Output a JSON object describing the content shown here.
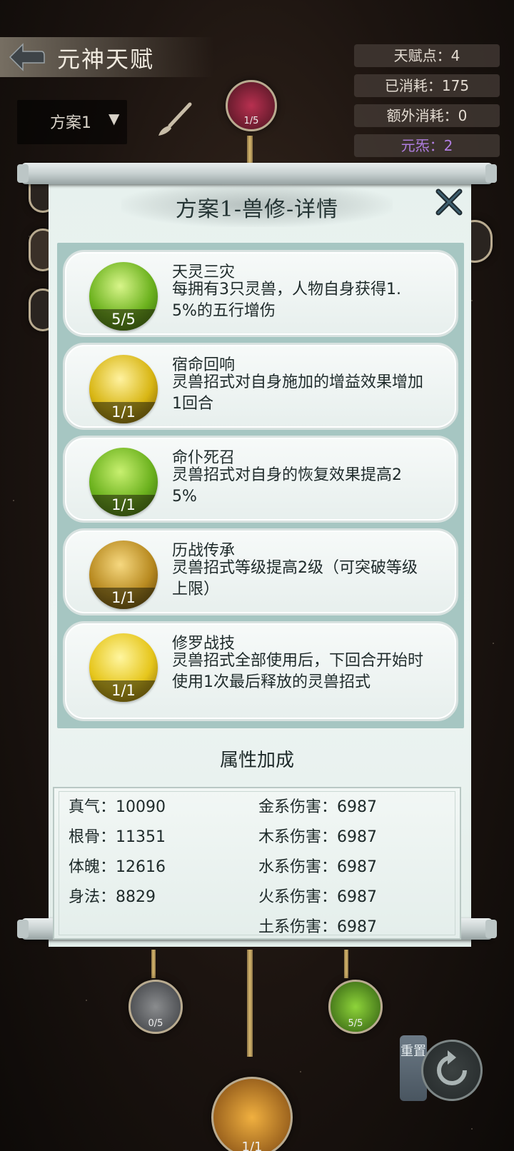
{
  "header": {
    "title": "元神天赋",
    "plan_select": "方案1"
  },
  "stats": [
    {
      "text": "天赋点：4"
    },
    {
      "text": "已消耗：175"
    },
    {
      "text": "额外消耗：0"
    },
    {
      "text": "元炁：2"
    }
  ],
  "tree": {
    "top_node_count": "1/5",
    "left_node_count": "0/5",
    "right_node_count": "5/5",
    "bottom_node_count": "1/1"
  },
  "modal": {
    "title": "方案1-兽修-详情",
    "talents": [
      {
        "name": "天灵三灾",
        "desc": "每拥有3只灵兽，人物自身获得1.5%的五行增伤",
        "level": "5/5",
        "color": "#7ec92a"
      },
      {
        "name": "宿命回响",
        "desc": "灵兽招式对自身施加的增益效果增加1回合",
        "level": "1/1",
        "color": "#d8b614"
      },
      {
        "name": "命仆死召",
        "desc": "灵兽招式对自身的恢复效果提高25%",
        "level": "1/1",
        "color": "#7ec92a"
      },
      {
        "name": "历战传承",
        "desc": "灵兽招式等级提高2级（可突破等级上限）",
        "level": "1/1",
        "color": "#c9a424"
      },
      {
        "name": "修罗战技",
        "desc": "灵兽招式全部使用后，下回合开始时使用1次最后释放的灵兽招式",
        "level": "1/1",
        "color": "#e6c61c"
      }
    ],
    "bonus_title": "属性加成",
    "attributes_left": [
      "真气：10090",
      "根骨：11351",
      "体魄：12616",
      "身法：8829"
    ],
    "attributes_right": [
      "金系伤害：6987",
      "木系伤害：6987",
      "水系伤害：6987",
      "火系伤害：6987",
      "土系伤害：6987"
    ]
  },
  "reset": {
    "label": "重置"
  }
}
